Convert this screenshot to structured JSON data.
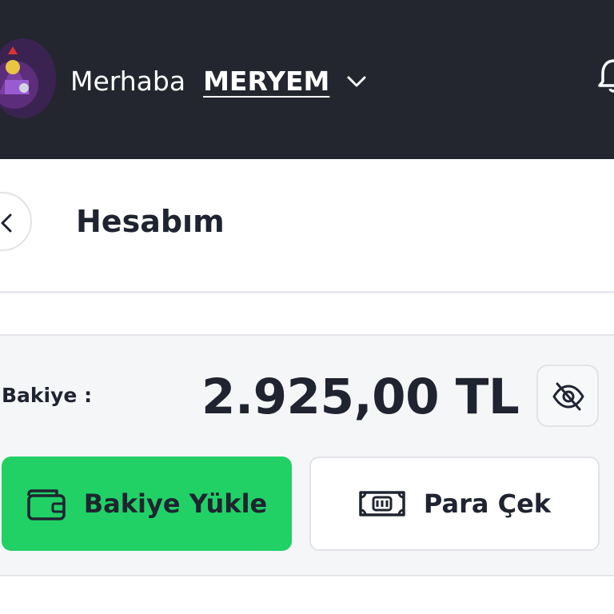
{
  "header": {
    "greeting": "Merhaba",
    "username": "MERYEM",
    "background": "#23262e"
  },
  "page": {
    "title": "Hesabım"
  },
  "balance": {
    "label": "Bakiye :",
    "amount": "2.925,00 TL"
  },
  "actions": {
    "load_label": "Bakiye Yükle",
    "withdraw_label": "Para Çek",
    "load_color": "#21d166"
  },
  "icons": [
    "avatar",
    "chevron-down-icon",
    "bell-icon",
    "back-arrow-icon",
    "eye-off-icon",
    "wallet-icon",
    "banknote-icon"
  ]
}
